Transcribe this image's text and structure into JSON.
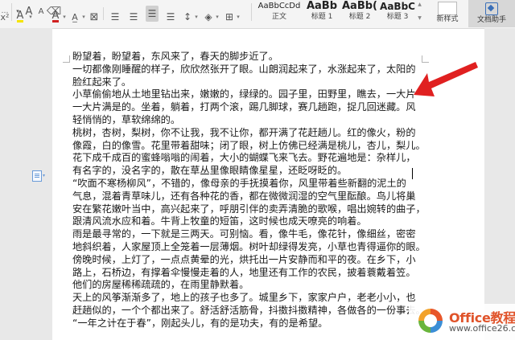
{
  "toolbar": {
    "row_glyphs": {
      "font_letter": "A",
      "font_letter_small": "A",
      "highlight_letter": "A",
      "font_color_letter": "A"
    }
  },
  "styles": [
    {
      "sample": "AaBbCcDd",
      "name": "正文"
    },
    {
      "sample": "AaBb",
      "name": "标题 1"
    },
    {
      "sample": "AaBb(",
      "name": "标题 2"
    },
    {
      "sample": "AaBbC",
      "name": "标题 3"
    }
  ],
  "new_style_label": "新样式",
  "assistant_label": "文档助手",
  "document": {
    "lines": [
      "盼望着，盼望着，东风来了，春天的脚步近了。",
      "一切都像刚睡醒的样子，欣欣然张开了眼。山朗润起来了，水涨起来了，太阳的",
      "脸红起来了。",
      "小草偷偷地从土地里钻出来，嫩嫩的，绿绿的。园子里，田野里，瞧去，一大片",
      "一大片满是的。坐着，躺着，打两个滚，踢几脚球，赛几趟跑，捉几回迷藏。风",
      "轻悄悄的，草软绵绵的。",
      "桃树，杏树，梨树，你不让我，我不让你，都开满了花赶趟儿。红的像火，粉的",
      "像霞，白的像雪。花里带着甜味；闭了眼，树上仿佛已经满是桃儿，杏儿，梨儿。",
      "花下成千成百的蜜蜂嗡嗡的闹着，大小的蝴蝶飞来飞去。野花遍地是：杂样儿，",
      "有名字的，没名字的，散在草丛里像眼睛像星星，还眨呀眨的。",
      "“吹面不寒杨柳风”，不错的，像母亲的手抚摸着你，风里带着些新翻的泥土的",
      "气息，混着青草味儿，还有各种花的香，都在微微润湿的空气里酝酿。鸟儿将巢",
      "安在繁花嫩叶当中，高兴起来了，呼朋引伴的卖弄清脆的歌喉，唱出婉转的曲子，",
      "跟清风流水应和着。牛背上牧童的短笛，这时候也成天嘹亮的响着。",
      "雨是最寻常的，一下就是三两天。可别恼。看，像牛毛，像花针，像细丝，密密",
      "地斜织着，人家屋顶上全笼着一层薄烟。树叶却绿得发亮，小草也青得逼你的眼。",
      "傍晚时候，上灯了，一点点黄晕的光，烘托出一片安静而和平的夜。在乡下，小",
      "路上，石桥边，有撑着伞慢慢走着的人，地里还有工作的农民，披着蓑戴着笠。",
      "他们的房屋稀稀疏疏的，在雨里静默着。",
      "天上的风筝渐渐多了，地上的孩子也多了。城里乡下，家家户户，老老小小，也",
      "赶趟似的，一个个都出来了。舒活舒活筋骨，抖擞抖擞精神，各做各的一份事去。",
      "“一年之计在于春”，刚起头儿，有的是功夫，有的是希望。"
    ]
  },
  "logo": {
    "title": "Office教程网",
    "url": "www.office26.com",
    "colors": {
      "orange": "#e8562a",
      "blue": "#3b8ed6",
      "green": "#69b53c"
    }
  },
  "arrow_color": "#e02020"
}
